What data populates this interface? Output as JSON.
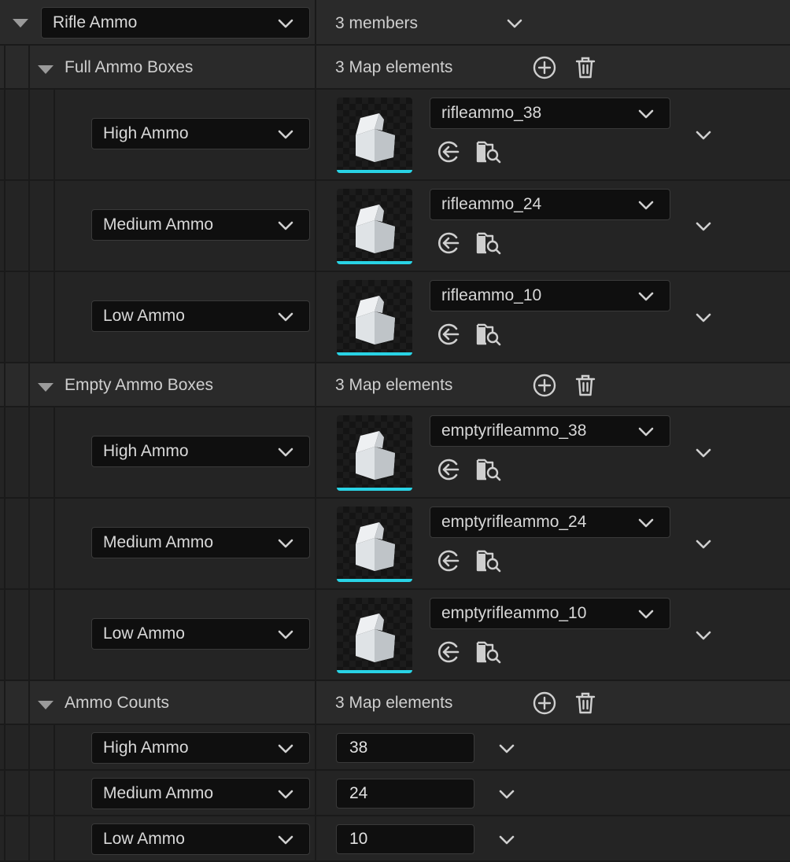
{
  "root": {
    "name": "Rifle Ammo",
    "members_text": "3 members"
  },
  "sections": [
    {
      "name": "Full Ammo Boxes",
      "count_text": "3 Map elements",
      "entries": [
        {
          "key": "High Ammo",
          "asset": "rifleammo_38"
        },
        {
          "key": "Medium Ammo",
          "asset": "rifleammo_24"
        },
        {
          "key": "Low Ammo",
          "asset": "rifleammo_10"
        }
      ]
    },
    {
      "name": "Empty Ammo Boxes",
      "count_text": "3 Map elements",
      "entries": [
        {
          "key": "High Ammo",
          "asset": "emptyrifleammo_38"
        },
        {
          "key": "Medium Ammo",
          "asset": "emptyrifleammo_24"
        },
        {
          "key": "Low Ammo",
          "asset": "emptyrifleammo_10"
        }
      ]
    },
    {
      "name": "Ammo Counts",
      "count_text": "3 Map elements",
      "entries": [
        {
          "key": "High Ammo",
          "value": "38"
        },
        {
          "key": "Medium Ammo",
          "value": "24"
        },
        {
          "key": "Low Ammo",
          "value": "10"
        }
      ]
    }
  ],
  "colors": {
    "accent": "#29d3e5",
    "background": "#242424",
    "field": "#0f0f0f"
  },
  "icons": {
    "expand": "triangle-down-icon",
    "add": "plus-circle-icon",
    "delete": "trash-icon",
    "use_selected": "arrow-left-circle-icon",
    "browse": "folder-search-icon",
    "dropdown": "chevron-down-icon"
  }
}
